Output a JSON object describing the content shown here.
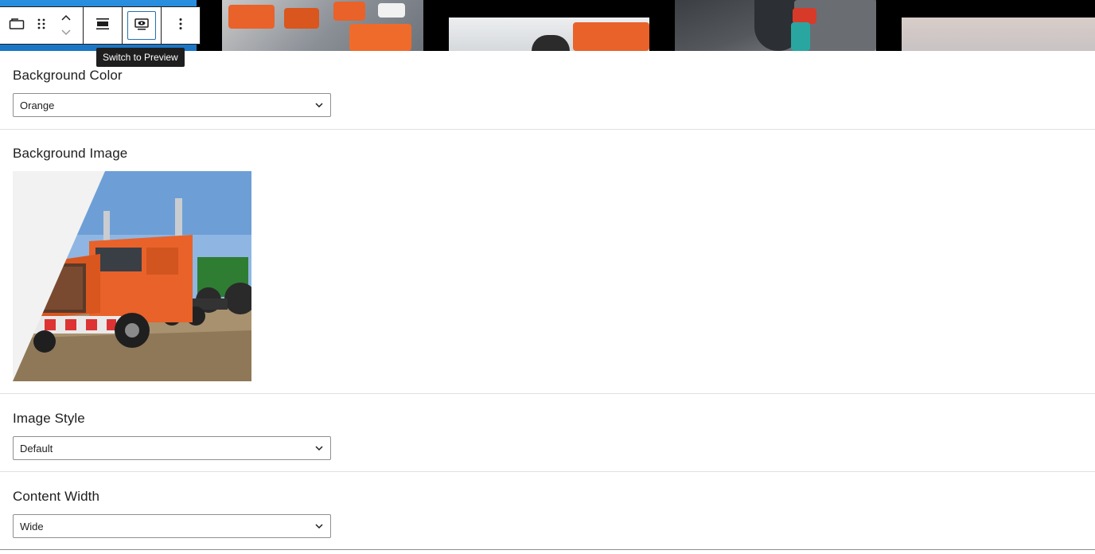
{
  "tooltip": {
    "text": "Switch to Preview"
  },
  "toolbar": {
    "block_icon": "block-icon",
    "drag_icon": "drag-handle-icon",
    "move_up_icon": "chevron-up-icon",
    "move_down_icon": "chevron-down-icon",
    "align_icon": "align-wide-icon",
    "preview_icon": "preview-eye-icon",
    "more_icon": "more-vertical-icon"
  },
  "fields": {
    "background_color": {
      "label": "Background Color",
      "value": "Orange"
    },
    "background_image": {
      "label": "Background Image"
    },
    "image_style": {
      "label": "Image Style",
      "value": "Default"
    },
    "content_width": {
      "label": "Content Width",
      "value": "Wide"
    }
  },
  "colors": {
    "accent": "#2271b1",
    "tooltip_bg": "#1e1e1e",
    "border": "#8c8f94",
    "truck_orange": "#e8622a"
  }
}
